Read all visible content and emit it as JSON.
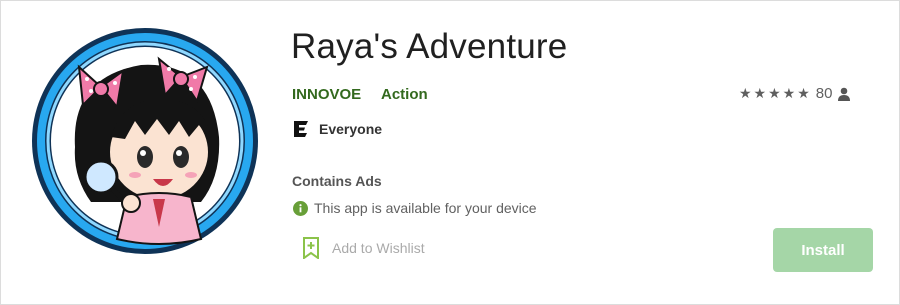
{
  "app": {
    "title": "Raya's Adventure",
    "developer": "INNOVOE",
    "genre": "Action",
    "rating_count": "80",
    "rating_stars": "★★★★★",
    "content_rating": "Everyone",
    "contains_ads": "Contains Ads",
    "availability": "This app is available for your device",
    "wishlist_label": "Add to Wishlist",
    "install_label": "Install"
  },
  "icons": {
    "app_icon": "raya-character-app-icon",
    "esrb": "esrb-everyone-icon",
    "info": "info-icon",
    "wishlist": "bookmark-plus-icon",
    "user": "person-icon"
  },
  "colors": {
    "accent_green": "#33691e",
    "install_button": "#a5d6a7",
    "icon_ring": "#1e9ce8"
  }
}
